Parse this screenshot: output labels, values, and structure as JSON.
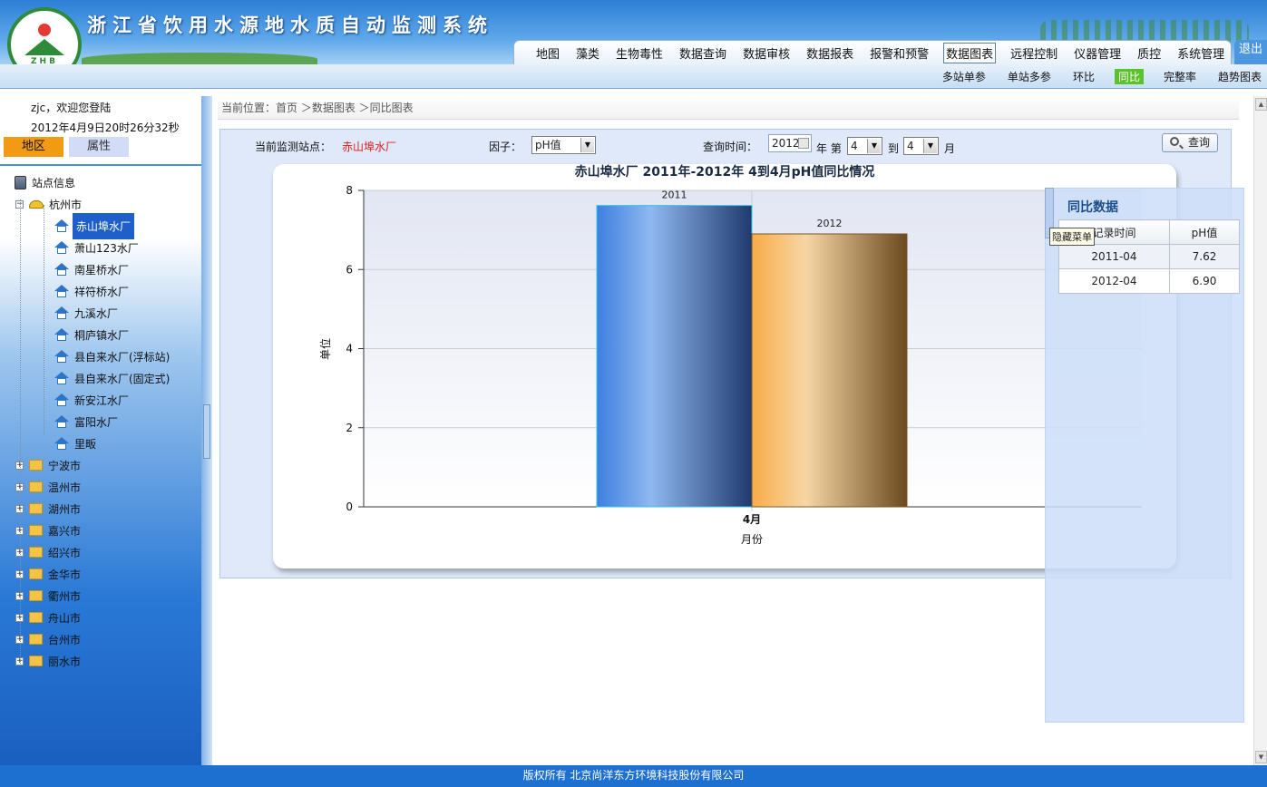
{
  "header": {
    "title": "浙江省饮用水源地水质自动监测系统",
    "logo_text": "ZHB",
    "logout": "退出"
  },
  "main_nav": [
    "地图",
    "藻类",
    "生物毒性",
    "数据查询",
    "数据审核",
    "数据报表",
    "报警和预警",
    "数据图表",
    "远程控制",
    "仪器管理",
    "质控",
    "系统管理"
  ],
  "main_nav_active": "数据图表",
  "sub_nav": [
    "多站单参",
    "单站多参",
    "环比",
    "同比",
    "完整率",
    "趋势图表"
  ],
  "sub_nav_active": "同比",
  "sidebar": {
    "welcome": "zjc，欢迎您登陆",
    "datetime": "2012年4月9日20时26分32秒",
    "tab_area": "地区",
    "tab_attr": "属性",
    "tree_root": "站点信息",
    "city_open": "杭州市",
    "stations": [
      "赤山埠水厂",
      "萧山123水厂",
      "南星桥水厂",
      "祥符桥水厂",
      "九溪水厂",
      "桐庐镇水厂",
      "县自来水厂(浮标站)",
      "县自来水厂(固定式)",
      "新安江水厂",
      "富阳水厂",
      "里畈"
    ],
    "cities": [
      "宁波市",
      "温州市",
      "湖州市",
      "嘉兴市",
      "绍兴市",
      "金华市",
      "衢州市",
      "舟山市",
      "台州市",
      "丽水市"
    ]
  },
  "breadcrumb": "当前位置：首页 ＞数据图表 ＞同比图表",
  "form": {
    "station_label": "当前监测站点：",
    "station_value": "赤山埠水厂",
    "factor_label": "因子：",
    "factor_value": "pH值",
    "time_label": "查询时间：",
    "year_value": "2012",
    "year_suffix": "年 第",
    "month_from": "4",
    "to_label": "到",
    "month_to": "4",
    "month_suffix": "月",
    "query_button": "查询"
  },
  "chart_data": {
    "type": "bar",
    "title": "赤山埠水厂 2011年-2012年 4到4月pH值同比情况",
    "xlabel": "月份",
    "ylabel": "单位",
    "categories": [
      "4月"
    ],
    "series": [
      {
        "name": "2011",
        "values": [
          7.62
        ],
        "color_from": "#3d7fe0",
        "color_mid": "#8fb8f0",
        "color_to": "#1f3a6e"
      },
      {
        "name": "2012",
        "values": [
          6.9
        ],
        "color_from": "#f8ac48",
        "color_mid": "#f7d6a5",
        "color_to": "#6a4a1e"
      }
    ],
    "ylim": [
      0,
      8
    ],
    "yticks": [
      0,
      2,
      4,
      6,
      8
    ],
    "grid": true
  },
  "compare": {
    "title": "同比数据",
    "col_time": "记录时间",
    "col_value": "pH值",
    "rows": [
      {
        "time": "2011-04",
        "value": "7.62"
      },
      {
        "time": "2012-04",
        "value": "6.90"
      }
    ],
    "tooltip": "隐藏菜单"
  },
  "footer": "版权所有 北京尚洋东方环境科技股份有限公司"
}
